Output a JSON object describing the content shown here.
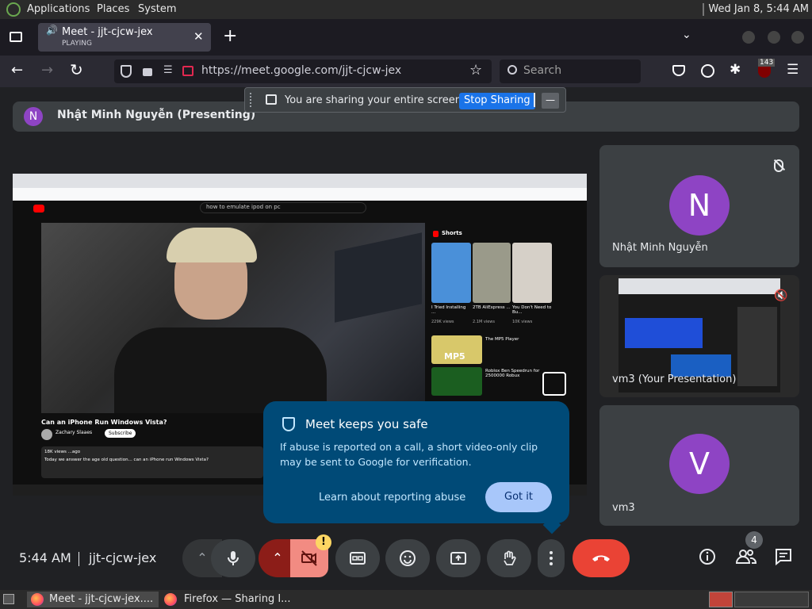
{
  "panel": {
    "applications": "Applications",
    "places": "Places",
    "system": "System",
    "clock": "Wed Jan  8,  5:44 AM"
  },
  "browser": {
    "tab_title": "Meet - jjt-cjcw-jex",
    "tab_status": "PLAYING",
    "url": "https://meet.google.com/jjt-cjcw-jex",
    "search_placeholder": "Search",
    "ext_badge": "143"
  },
  "share_banner": {
    "message": "You are sharing your entire screen.",
    "stop_label": "Stop Sharing"
  },
  "presenter": {
    "initial": "N",
    "label": "Nhật Minh Nguyễn (Presenting)"
  },
  "presentation": {
    "search_query": "how to emulate ipod on pc",
    "video_title": "Can an iPhone Run Windows Vista?",
    "channel": "Zachary Slaaes",
    "subscribe": "Subscribe",
    "desc_line1": "18K views  ...ago",
    "desc_line2": "Today we answer the age old question... can an iPhone run Windows Vista?",
    "shorts_heading": "Shorts",
    "shorts": [
      {
        "title": "I Tried Installing ...",
        "views": "229K views"
      },
      {
        "title": "2TB AliExpress ...",
        "views": "2.1M views"
      },
      {
        "title": "You Don't Need to Bu...",
        "views": "10K views"
      }
    ],
    "rec1_title": "The MP5 Player",
    "rec2_title": "Roblox Ben Speedrun for 2500000 Robux",
    "mp5": "MP5"
  },
  "tiles": [
    {
      "name": "Nhật Minh Nguyễn",
      "initial": "N"
    },
    {
      "name": "vm3 (Your Presentation)"
    },
    {
      "name": "vm3",
      "initial": "V"
    }
  ],
  "safety_popup": {
    "title": "Meet keeps you safe",
    "body": "If abuse is reported on a call, a short video-only clip may be sent to Google for verification.",
    "learn_link": "Learn about reporting abuse",
    "got_it": "Got it"
  },
  "bottom_bar": {
    "time": "5:44 AM",
    "meeting_code": "jjt-cjcw-jex",
    "people_count": "4",
    "warning": "!"
  },
  "taskbar": {
    "item1": "Meet - jjt-cjcw-jex....",
    "item2": "Firefox — Sharing I..."
  },
  "colors": {
    "accent": "#1a73e8",
    "end_call": "#ea4335",
    "popup_bg": "#004a77",
    "avatar": "#8e44c4",
    "camera_off": "#f28b82"
  }
}
